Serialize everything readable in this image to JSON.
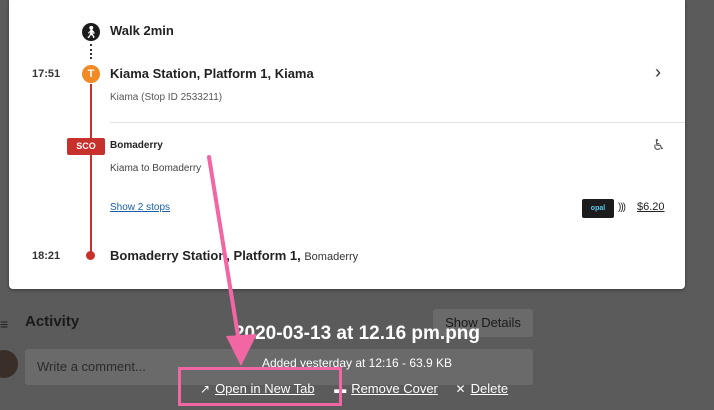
{
  "journey": {
    "walk_icon": "person-walking-icon",
    "walk_label": "Walk 2min",
    "leg1": {
      "time": "17:51",
      "train_icon_letter": "T",
      "station": "Kiama Station, Platform 1, Kiama",
      "stop_info": "Kiama (Stop ID 2533211)"
    },
    "service": {
      "badge": "SCO",
      "route_name": "Bomaderry",
      "direction": "Kiama to Bomaderry",
      "stops_link": "Show 2 stops",
      "card_label": "opal",
      "fare": "$6.20"
    },
    "leg2": {
      "time": "18:21",
      "station": "Bomaderry Station, Platform 1,",
      "station_suburb": "Bomaderry"
    },
    "colors": {
      "route_red": "#c8312b",
      "train_orange": "#f18a24",
      "link_blue": "#1a5ea8",
      "highlight_pink": "#f266a4"
    }
  },
  "activity": {
    "title": "Activity",
    "show_details": "Show Details",
    "comment_placeholder": "Write a comment..."
  },
  "overlay": {
    "filename": "2020-03-13 at 12.16 pm.png",
    "meta": "Added yesterday at 12:16 - 63.9 KB",
    "open_new_tab": "Open in New Tab",
    "remove_cover": "Remove Cover",
    "delete": "Delete"
  }
}
